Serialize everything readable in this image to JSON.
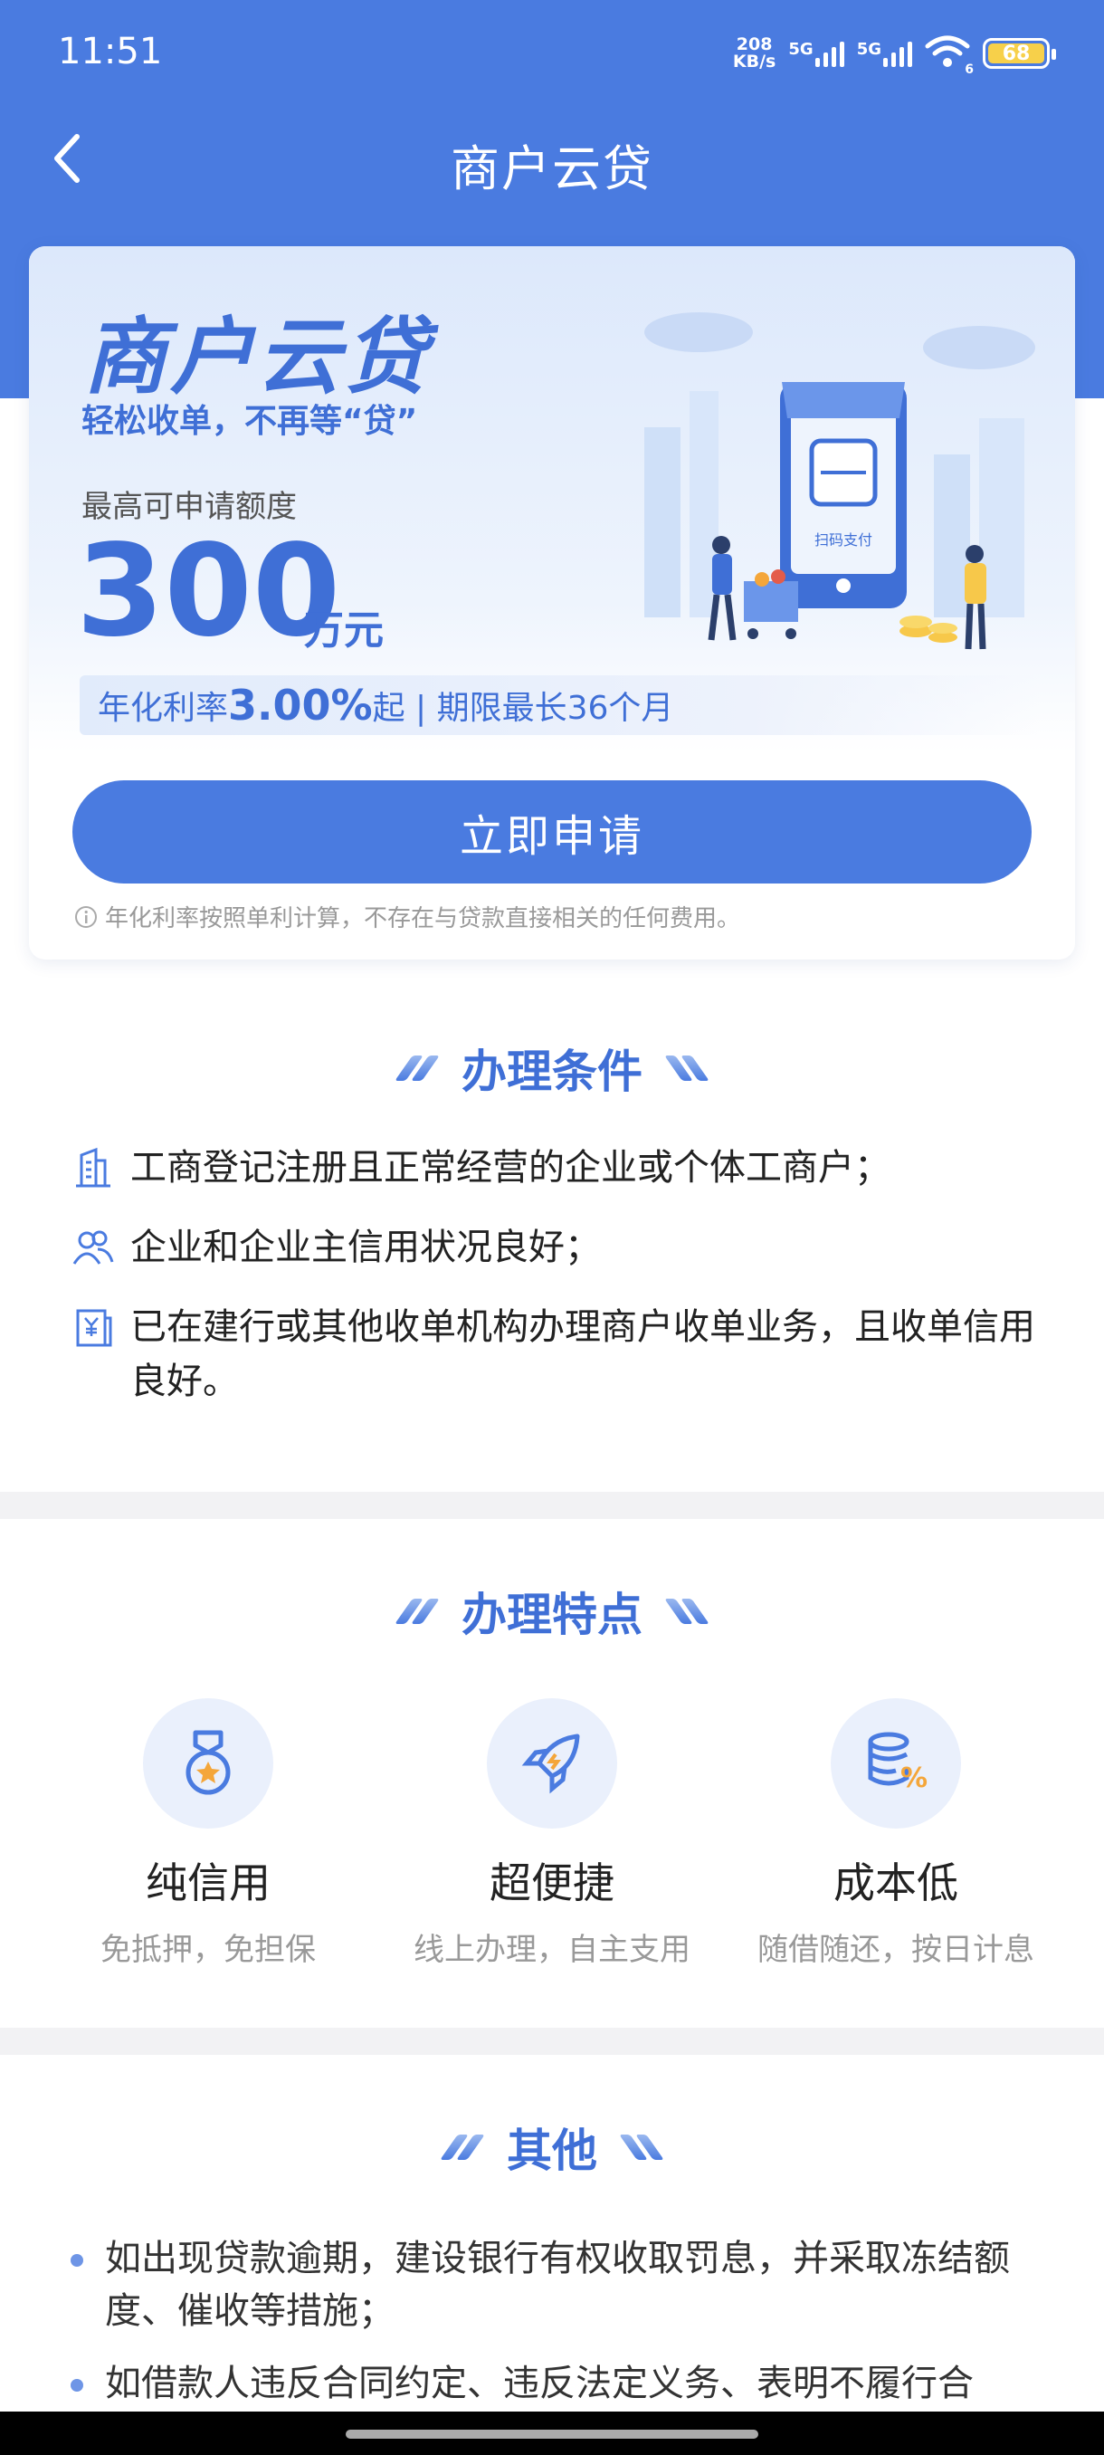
{
  "status": {
    "time": "11:51",
    "speed_top": "208",
    "speed_bottom": "KB/s",
    "net1": "5G",
    "net2": "5G",
    "wifi_sub": "6",
    "battery": "68"
  },
  "header": {
    "title": "商户云贷"
  },
  "hero": {
    "title": "商户云贷",
    "subtitle": "轻松收单，不再等“贷”",
    "limit_label": "最高可申请额度",
    "limit_value": "300",
    "limit_unit": "万元",
    "rate_prefix": "年化利率",
    "rate_value": "3.00%",
    "rate_suffix": "起 | 期限最长36个月",
    "scan_label": "扫码支付",
    "apply_button": "立即申请",
    "note": "年化利率按照单利计算，不存在与贷款直接相关的任何费用。"
  },
  "conditions": {
    "title": "办理条件",
    "items": [
      {
        "icon": "building-icon",
        "text": "工商登记注册且正常经营的企业或个体工商户；"
      },
      {
        "icon": "people-icon",
        "text": "企业和企业主信用状况良好；"
      },
      {
        "icon": "receipt-icon",
        "text": "已在建行或其他收单机构办理商户收单业务，且收单信用良好。"
      }
    ]
  },
  "features": {
    "title": "办理特点",
    "items": [
      {
        "icon": "medal-icon",
        "name": "纯信用",
        "desc": "免抵押，免担保"
      },
      {
        "icon": "rocket-icon",
        "name": "超便捷",
        "desc": "线上办理，自主支用"
      },
      {
        "icon": "coins-percent-icon",
        "name": "成本低",
        "desc": "随借随还，按日计息"
      }
    ]
  },
  "other": {
    "title": "其他",
    "items": [
      {
        "text": "如出现贷款逾期，建设银行有权收取罚息，并采取冻结额度、催收等措施；"
      },
      {
        "text": "如借款人违反合同约定、违反法定义务、表明不履行合"
      }
    ]
  },
  "colors": {
    "brand": "#4a7be0",
    "accent_text": "#3f6fd6"
  }
}
